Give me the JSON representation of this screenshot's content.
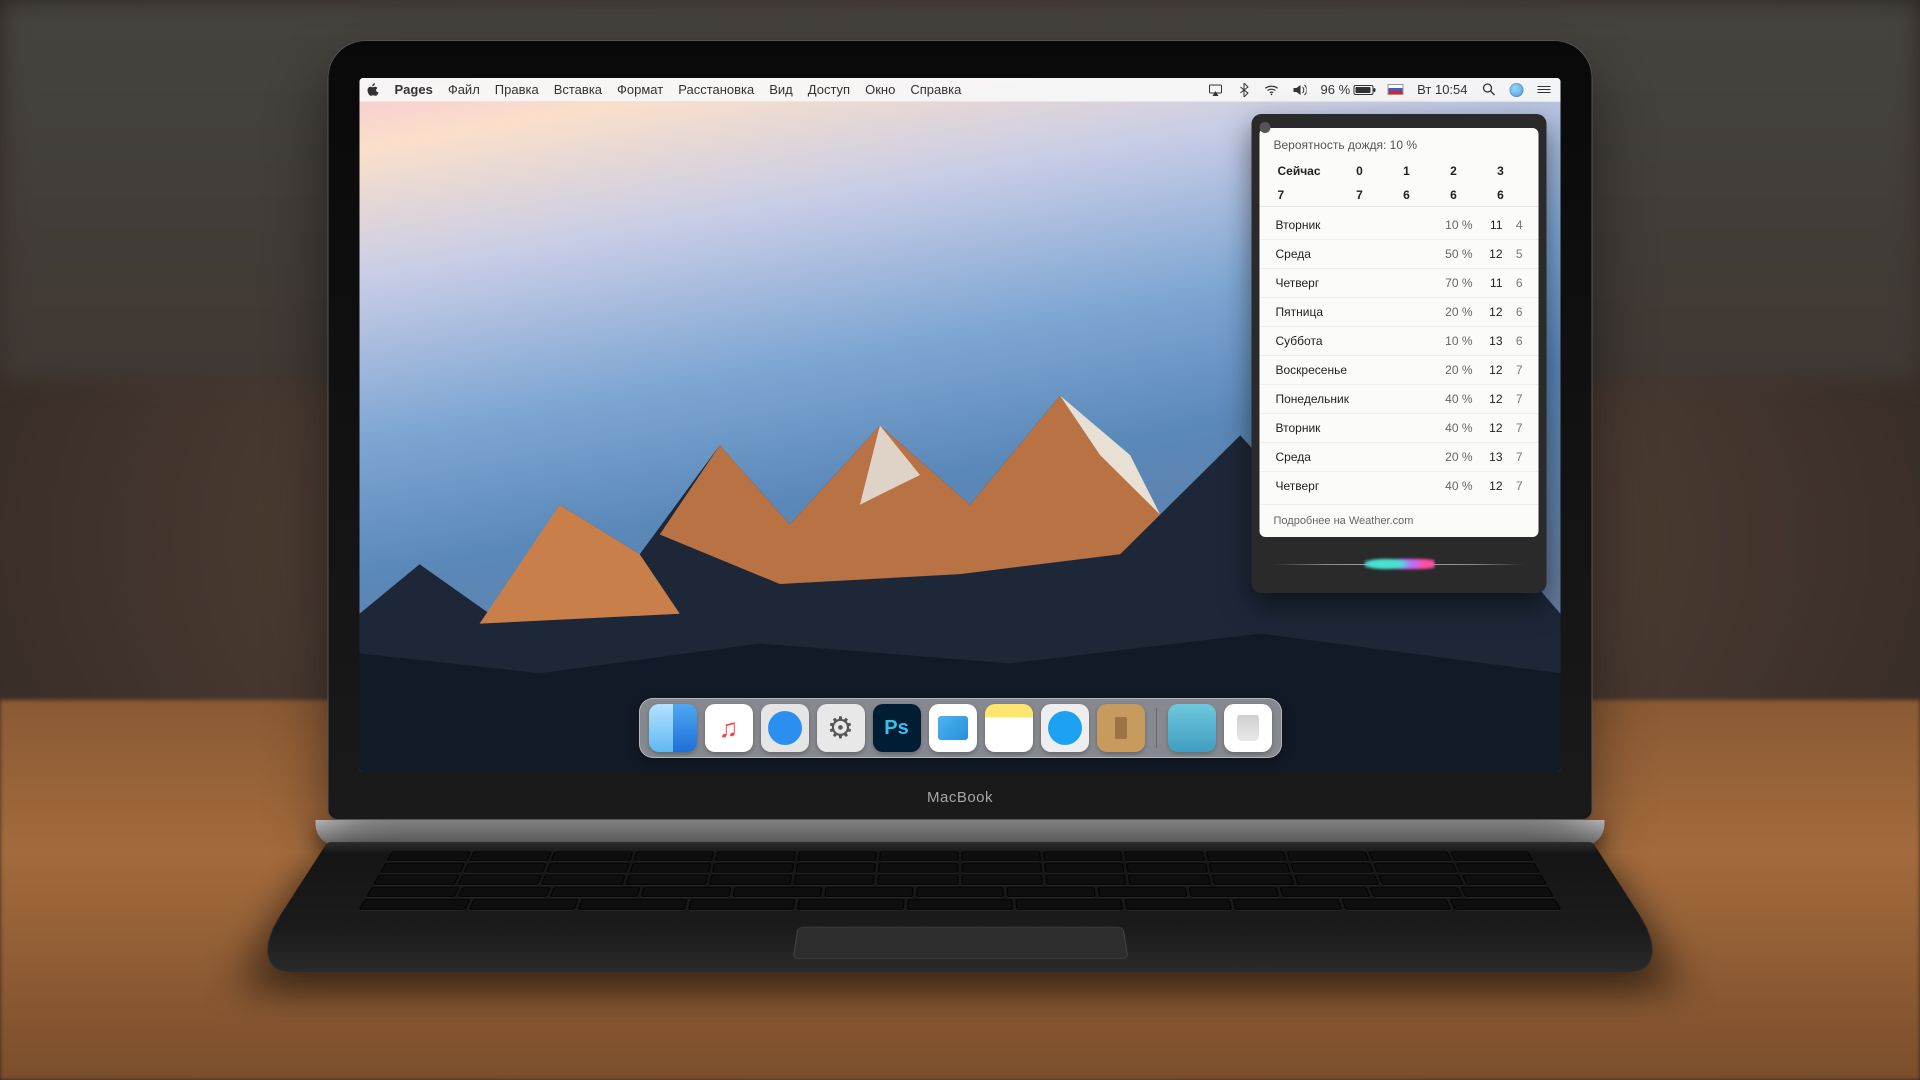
{
  "menubar": {
    "app": "Pages",
    "items": [
      "Файл",
      "Правка",
      "Вставка",
      "Формат",
      "Расстановка",
      "Вид",
      "Доступ",
      "Окно",
      "Справка"
    ],
    "battery_pct": "96 %",
    "clock": "Вт 10:54"
  },
  "siri": {
    "header": "Вероятность дождя: 10 %",
    "hour_labels": [
      "Сейчас",
      "0",
      "1",
      "2",
      "3"
    ],
    "hour_values": [
      "7",
      "7",
      "6",
      "6",
      "6"
    ],
    "days": [
      {
        "name": "Вторник",
        "pct": "10 %",
        "hi": "11",
        "lo": "4"
      },
      {
        "name": "Среда",
        "pct": "50 %",
        "hi": "12",
        "lo": "5"
      },
      {
        "name": "Четверг",
        "pct": "70 %",
        "hi": "11",
        "lo": "6"
      },
      {
        "name": "Пятница",
        "pct": "20 %",
        "hi": "12",
        "lo": "6"
      },
      {
        "name": "Суббота",
        "pct": "10 %",
        "hi": "13",
        "lo": "6"
      },
      {
        "name": "Воскресенье",
        "pct": "20 %",
        "hi": "12",
        "lo": "7"
      },
      {
        "name": "Понедельник",
        "pct": "40 %",
        "hi": "12",
        "lo": "7"
      },
      {
        "name": "Вторник",
        "pct": "40 %",
        "hi": "12",
        "lo": "7"
      },
      {
        "name": "Среда",
        "pct": "20 %",
        "hi": "13",
        "lo": "7"
      },
      {
        "name": "Четверг",
        "pct": "40 %",
        "hi": "12",
        "lo": "7"
      }
    ],
    "footer": "Подробнее на Weather.com"
  },
  "laptop_label": "MacBook",
  "dock": [
    "finder",
    "music",
    "safari",
    "prefs",
    "ps",
    "preview",
    "notes",
    "twitter",
    "contacts",
    "display",
    "trash"
  ]
}
